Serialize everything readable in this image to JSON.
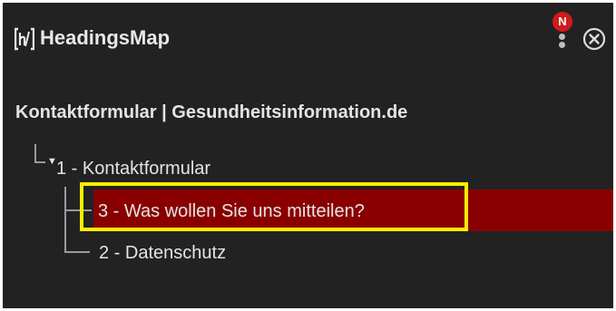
{
  "app": {
    "title": "HeadingsMap",
    "logo_icon": "headingsmap-logo-icon",
    "notification_badge": "N",
    "notification_color": "#d01c1c",
    "menu_icon": "kebab-menu-icon",
    "close_icon": "close-circle-icon"
  },
  "document": {
    "title": "Kontaktformular | Gesundheitsinformation.de"
  },
  "tree": {
    "items": [
      {
        "label": "1 - Kontaktformular",
        "expanded": true
      },
      {
        "label": "3 - Was wollen Sie uns mitteilen?",
        "selected": true,
        "highlight_color": "#8a0000"
      },
      {
        "label": "2 - Datenschutz"
      }
    ],
    "expand_icon": "triangle-down-icon"
  },
  "annotation": {
    "focus_box_color": "#ffee00"
  }
}
